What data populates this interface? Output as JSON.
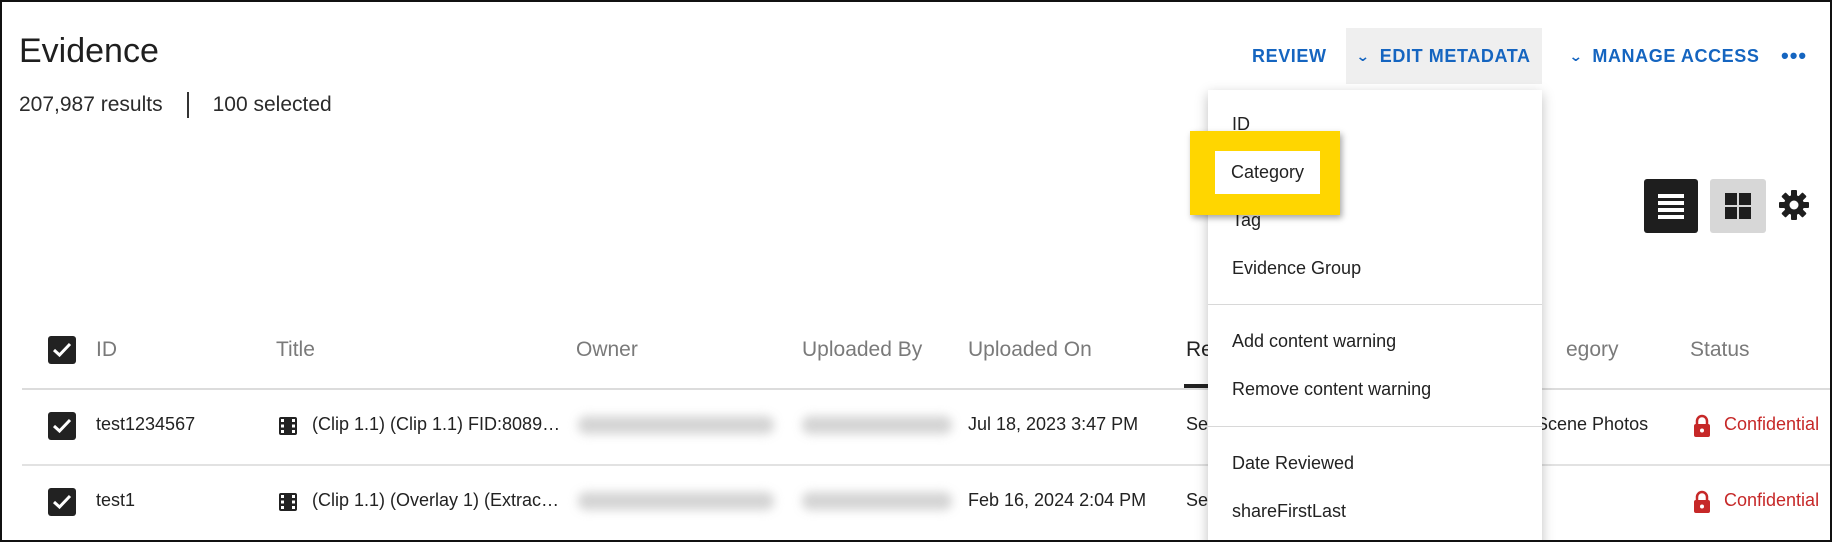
{
  "page": {
    "title": "Evidence",
    "results": "207,987 results",
    "selected": "100 selected"
  },
  "actions": {
    "review": "REVIEW",
    "edit_metadata": "EDIT METADATA",
    "manage_access": "MANAGE ACCESS",
    "more": "•••"
  },
  "view": {
    "list_icon": "list-view-icon",
    "grid_icon": "grid-view-icon",
    "settings_icon": "gear-icon"
  },
  "table": {
    "columns": {
      "id": "ID",
      "title": "Title",
      "owner": "Owner",
      "uploaded_by": "Uploaded By",
      "uploaded_on": "Uploaded On",
      "reviewed": "Re",
      "category": "egory",
      "status": "Status"
    },
    "rows": [
      {
        "id": "test1234567",
        "title": "(Clip 1.1) (Clip 1.1) FID:8089…",
        "uploaded_on": "Jul 18, 2023 3:47 PM",
        "reviewed": "Se",
        "category": "Scene Photos",
        "status": "Confidential"
      },
      {
        "id": "test1",
        "title": "(Clip 1.1) (Overlay 1) (Extrac…",
        "uploaded_on": "Feb 16, 2024 2:04 PM",
        "reviewed": "Se",
        "category": "",
        "status": "Confidential"
      }
    ]
  },
  "menu": {
    "items": {
      "id": "ID",
      "category": "Category",
      "tag": "Tag",
      "evidence_group": "Evidence Group",
      "add_warning": "Add content warning",
      "remove_warning": "Remove content warning",
      "date_reviewed": "Date Reviewed",
      "share": "shareFirstLast"
    }
  },
  "colors": {
    "accent": "#1565c0",
    "highlight": "#ffd600",
    "confidential": "#c62828"
  }
}
